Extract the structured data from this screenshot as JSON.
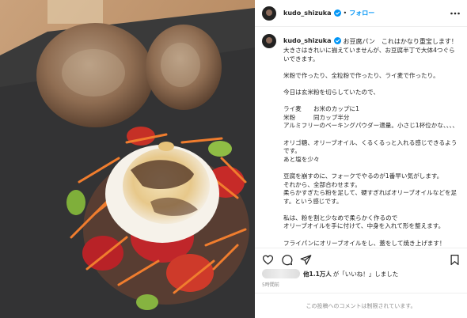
{
  "post": {
    "image_alt": "photo of two round baked patties and an egg salad on shredded carrots and tomatoes on a slate plate"
  },
  "header": {
    "username": "kudo_shizuka",
    "dot": "•",
    "follow_label": "フォロー",
    "more_icon": "more-horizontal-icon"
  },
  "caption": {
    "username": "kudo_shizuka",
    "title": "お豆腐パン　これはかなり重宝します！",
    "body": "大きさはきれいに揃えていませんが、お豆腐半丁で大体4つぐらいできます。\n\n米粉で作ったり、全粒粉で作ったり、ライ麦で作ったり。\n\n今日は玄米粉を切らしていたので、\n\nライ麦　　お米のカップに1\n米粉　　　同カップ半分\nアルミフリーのベーキングパウダー適量。小さじ1杯位かな、、、、\n\nオリゴ糖、オリーブオイル、くるくるっと入れる感じできるようです。\nあと塩を少々\n\n豆腐を崩すのに、フォークでやるのが1番早い気がします。\nそれから、全部合わせます。\n柔らかすぎたら粉を足して、硬すぎればオリーブオイルなどを足す。という感じです。\n\n私は、粉を割と少なめで柔らかく作るので\nオリーブオイルを手に付けて、中身を入れて形を整えます。\n\nフライパンにオリーブオイルをし、蓋をして焼き上げます！\n\nソーセージを入れたり、ひき肉を入れたり、　レパートリーが広"
  },
  "actions": {
    "like_icon": "heart-icon",
    "comment_icon": "comment-icon",
    "share_icon": "share-icon",
    "save_icon": "bookmark-icon"
  },
  "likes": {
    "count": "他1.1万人",
    "suffix": "が「いいね！」しました"
  },
  "date": "5時間前",
  "footer_text": "この投稿へのコメントは制限されています。",
  "colors": {
    "accent": "#0095f6",
    "text": "#262626",
    "muted": "#8e8e8e",
    "border": "#efefef"
  }
}
